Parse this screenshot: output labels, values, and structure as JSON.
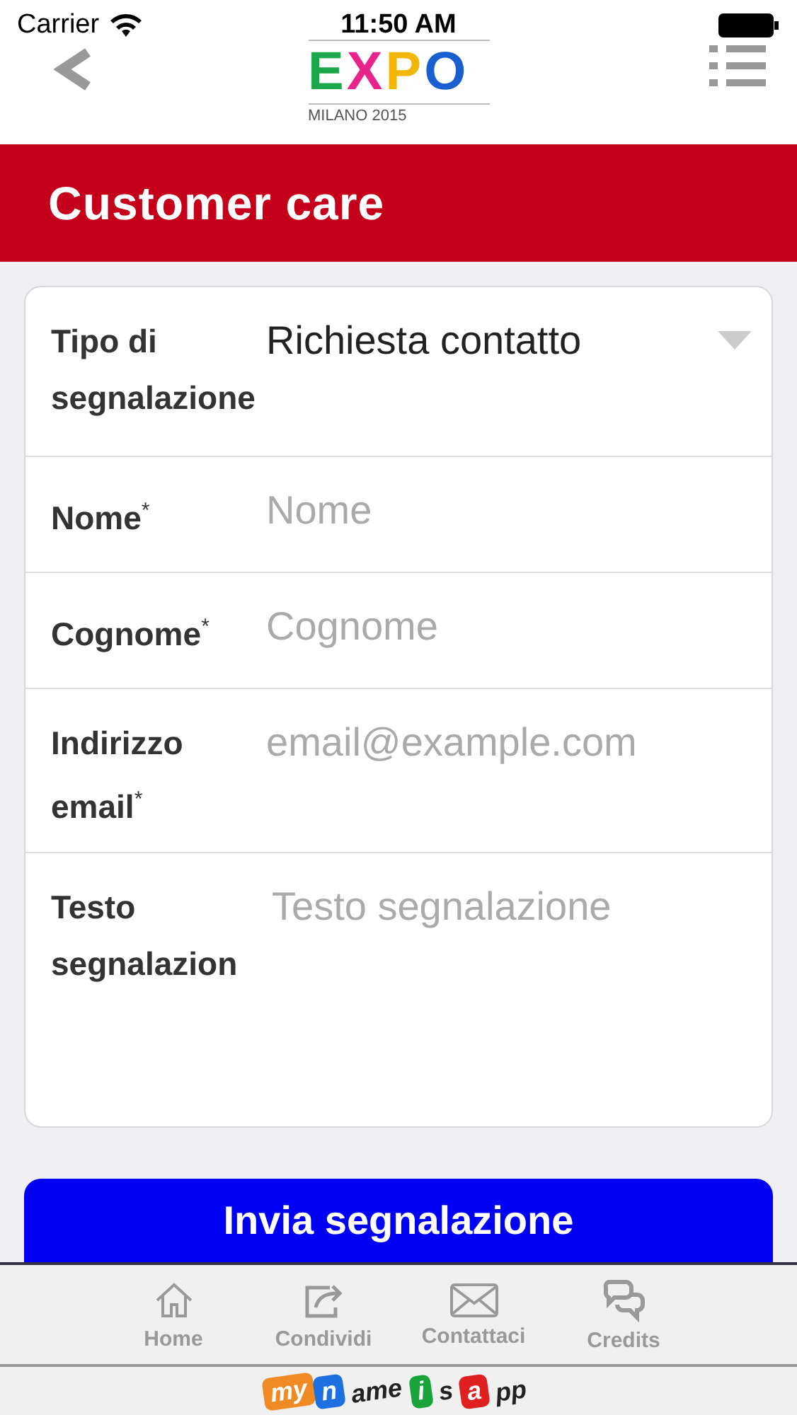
{
  "status_bar": {
    "carrier": "Carrier",
    "time": "11:50 AM"
  },
  "header": {
    "logo_letters": [
      {
        "text": "E",
        "color": "#1aa84a"
      },
      {
        "text": "X",
        "color": "#e8238a"
      },
      {
        "text": "P",
        "color": "#f2b705"
      },
      {
        "text": "O",
        "color": "#1a5fd0"
      }
    ],
    "logo_caption": "MILANO 2015"
  },
  "page_title": "Customer care",
  "form": {
    "rows": [
      {
        "kind": "select",
        "label": "Tipo di segnalazione",
        "value": "Richiesta contatto"
      },
      {
        "kind": "input",
        "label": "Nome$^{*}$",
        "placeholder": "Nome"
      },
      {
        "kind": "input",
        "label": "Cognome$^{*}$",
        "placeholder": "Cognome"
      },
      {
        "kind": "input",
        "label": "Indirizzo email$^{*}$",
        "placeholder": "email@example.com"
      },
      {
        "kind": "textarea",
        "label": "Testo segnalazion",
        "placeholder": "Testo segnalazione"
      }
    ]
  },
  "submit_button": "Invia segnalazione",
  "tab_bar": [
    {
      "kind": "home",
      "label": "Home"
    },
    {
      "kind": "share",
      "label": "Condividi"
    },
    {
      "kind": "mail",
      "label": "Contattaci"
    },
    {
      "kind": "chat",
      "label": "Credits"
    }
  ],
  "footer_logo": [
    {
      "text": "my",
      "color": "#f08a24"
    },
    {
      "text": "n",
      "color": "#1e6fe0"
    },
    {
      "text": "ame"
    },
    {
      "text": "i",
      "color": "#1aa33a"
    },
    {
      "text": "s"
    },
    {
      "text": "a",
      "color": "#e02020"
    },
    {
      "text": "pp"
    }
  ]
}
